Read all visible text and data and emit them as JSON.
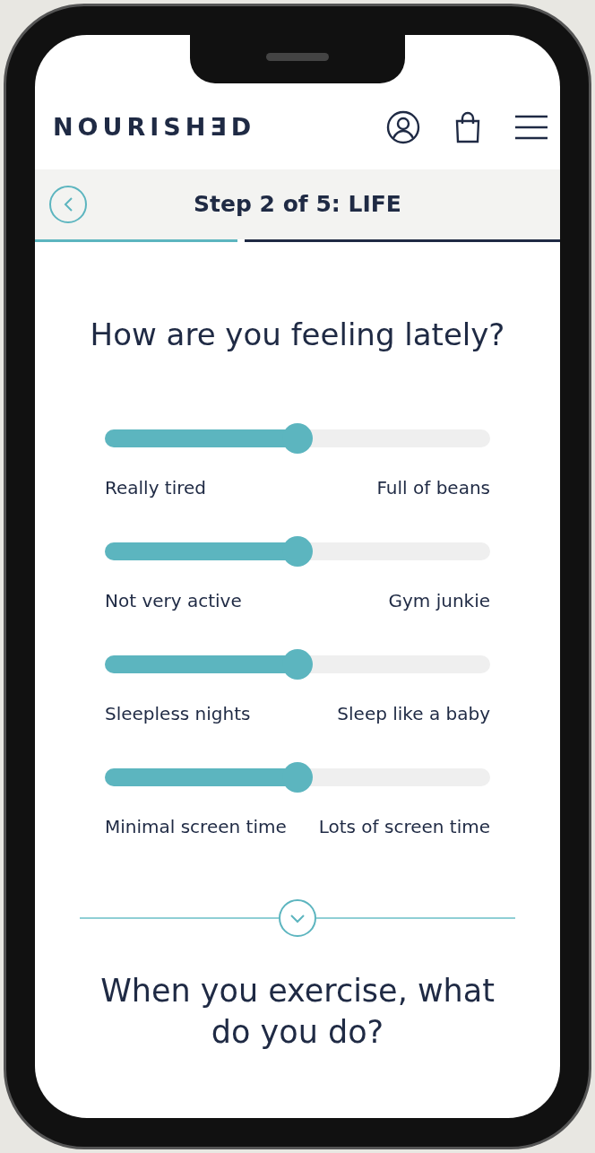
{
  "header": {
    "logo": "NOURISHƎD"
  },
  "step_bar": {
    "title": "Step 2 of 5: LIFE",
    "level": 0.4
  },
  "question": "How are you feeling lately?",
  "sliders": [
    {
      "left": "Really tired",
      "right": "Full of beans",
      "level": 0.5
    },
    {
      "left": "Not very active",
      "right": "Gym junkie",
      "level": 0.5
    },
    {
      "left": "Sleepless nights",
      "right": "Sleep like a baby",
      "level": 0.5
    },
    {
      "left": "Minimal screen time",
      "right": "Lots of screen time",
      "level": 0.5
    }
  ],
  "next_question": "When you exercise, what do you do?"
}
